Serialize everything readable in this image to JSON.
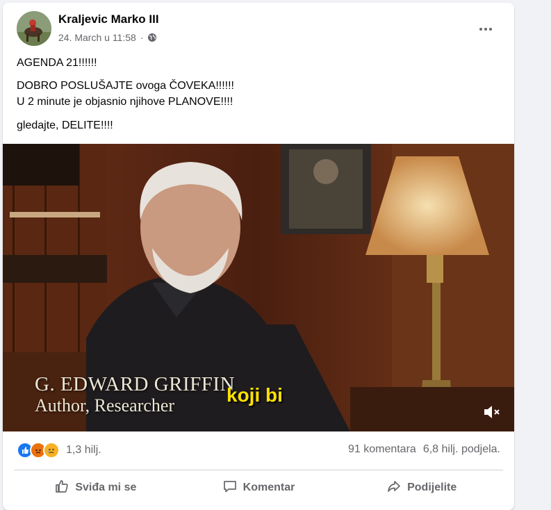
{
  "post": {
    "author": "Kraljevic Marko III",
    "date": "24. March u 11:58",
    "separator": "·",
    "audience_icon": "globe-icon",
    "more_icon": "more-dots-icon",
    "lines": [
      "AGENDA 21!!!!!!",
      "DOBRO POSLUŠAJTE ovoga ČOVEKA!!!!!!",
      "U 2 minute je objasnio njihove PLANOVE!!!!",
      "gledajte, DELITE!!!!"
    ]
  },
  "video": {
    "caption_name": "G. EDWARD GRIFFIN",
    "caption_title": "Author, Researcher",
    "subtitle": "koji bi",
    "mute_icon": "volume-muted-icon"
  },
  "reactions": {
    "icons": [
      "like-icon",
      "angry-icon",
      "sad-icon"
    ],
    "count": "1,3 hilj.",
    "comments": "91 komentara",
    "shares": "6,8 hilj. podjela."
  },
  "actions": {
    "like": "Sviđa mi se",
    "comment": "Komentar",
    "share": "Podijelite"
  },
  "colors": {
    "like_blue": "#1877f2",
    "angry": "#e9710f",
    "sad": "#f7b125",
    "subtitle_yellow": "#ffe100"
  }
}
